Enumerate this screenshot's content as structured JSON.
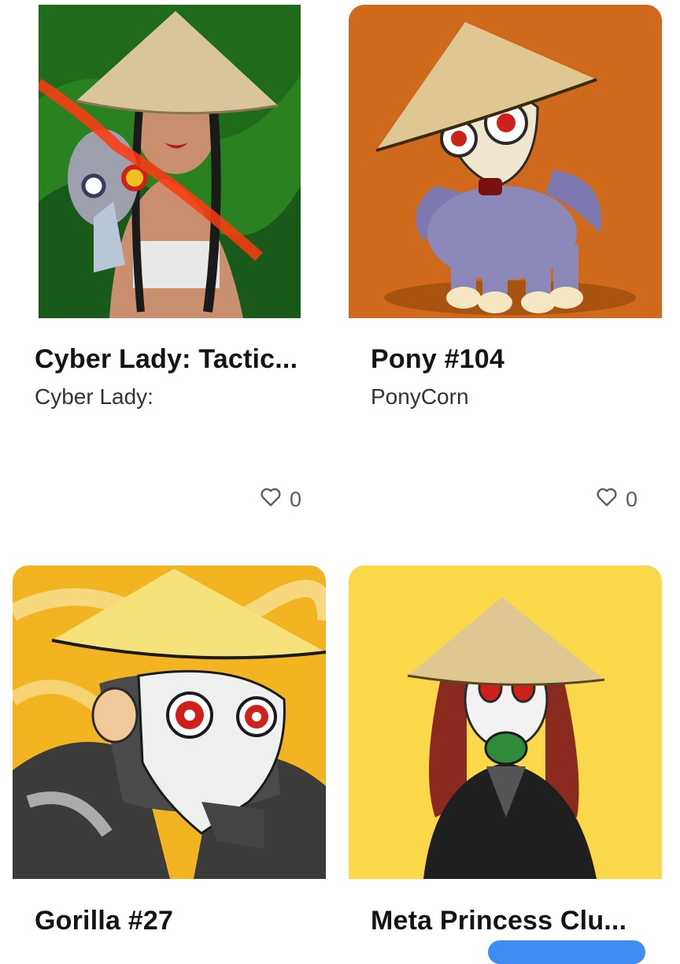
{
  "cards": [
    {
      "title": "Cyber Lady: Tactic...",
      "collection": "Cyber Lady:",
      "likes": "0",
      "image_bg": "#1f6b1a",
      "image_desc_icon": "cyber-lady-artwork"
    },
    {
      "title": "Pony #104",
      "collection": "PonyCorn",
      "likes": "0",
      "image_bg": "#cf6a1d",
      "image_desc_icon": "pony-artwork"
    },
    {
      "title": "Gorilla #27",
      "collection": "",
      "likes": "",
      "image_bg": "#f2b521",
      "image_desc_icon": "gorilla-artwork"
    },
    {
      "title": "Meta Princess Clu...",
      "collection": "",
      "likes": "",
      "image_bg": "#fbd84a",
      "image_desc_icon": "meta-princess-artwork"
    }
  ],
  "colors": {
    "accent": "#3f8cf2",
    "heart": "#555d66"
  }
}
